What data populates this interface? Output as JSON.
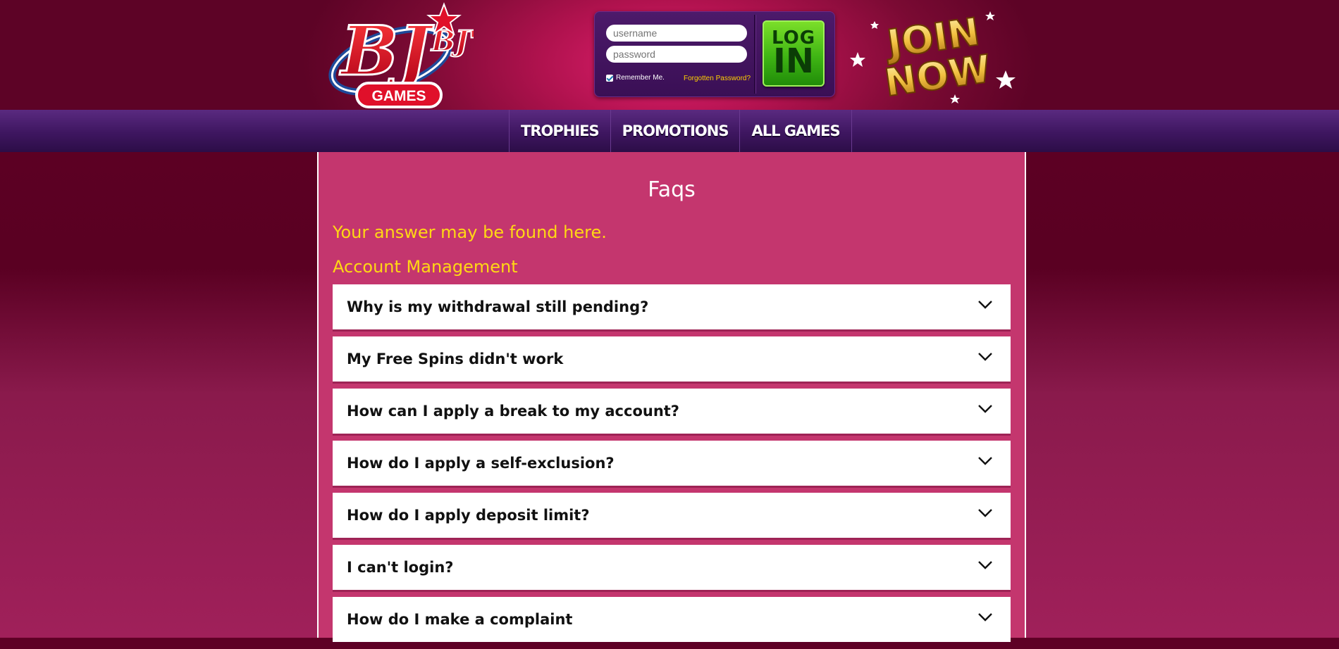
{
  "header": {
    "logo_text": "BJ's",
    "logo_sub": "GAMES",
    "username_placeholder": "username",
    "password_placeholder": "password",
    "remember_label": "Remember Me.",
    "forgot_label": "Forgotten Password?",
    "login_top": "LOG",
    "login_bottom": "IN",
    "join_top": "JOIN",
    "join_bottom": "NOW"
  },
  "nav": {
    "items": [
      {
        "label": "TROPHIES"
      },
      {
        "label": "PROMOTIONS"
      },
      {
        "label": "ALL GAMES"
      }
    ]
  },
  "main": {
    "title": "Faqs",
    "intro": "Your answer may be found here.",
    "section": "Account Management",
    "faqs": [
      {
        "question": "Why is my withdrawal still pending?"
      },
      {
        "question": "My Free Spins didn't work"
      },
      {
        "question": "How can I apply a break to my account?"
      },
      {
        "question": "How do I apply a self-exclusion?"
      },
      {
        "question": "How do I apply deposit limit?"
      },
      {
        "question": "I can't login?"
      },
      {
        "question": "How do I make a complaint"
      }
    ]
  },
  "colors": {
    "content_bg": "#c4366e",
    "accent_yellow": "#ffd814",
    "nav_purple": "#3e1660",
    "login_green": "#3fb514"
  }
}
